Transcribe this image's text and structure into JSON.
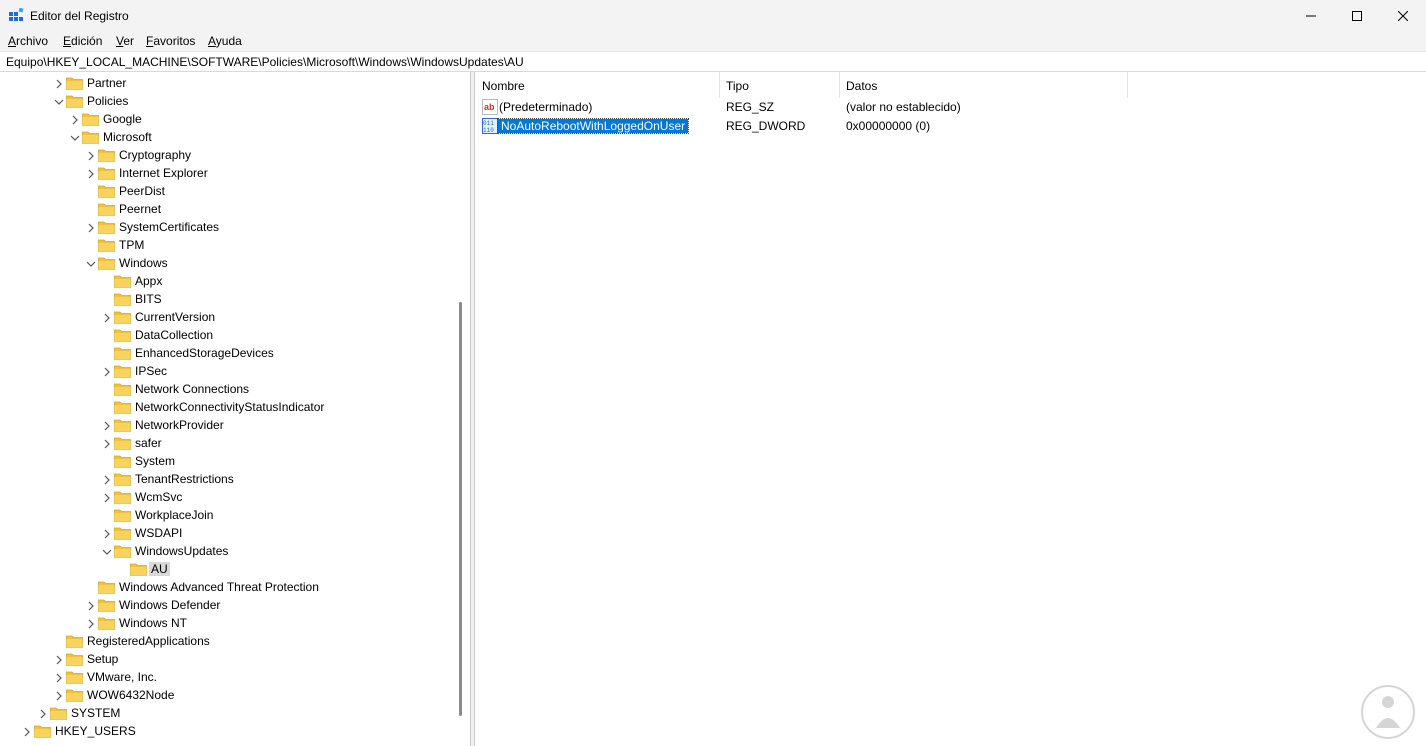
{
  "window": {
    "title": "Editor del Registro",
    "accent": "#0078d7",
    "folder_color": "#f2c23a"
  },
  "menu": [
    {
      "label": "Archivo",
      "u": "A",
      "rest": "rchivo"
    },
    {
      "label": "Edición",
      "u": "E",
      "rest": "dición"
    },
    {
      "label": "Ver",
      "u": "V",
      "rest": "er"
    },
    {
      "label": "Favoritos",
      "u": "F",
      "rest": "avoritos"
    },
    {
      "label": "Ayuda",
      "u": "A",
      "rest": "yuda"
    }
  ],
  "address": "Equipo\\HKEY_LOCAL_MACHINE\\SOFTWARE\\Policies\\Microsoft\\Windows\\WindowsUpdates\\AU",
  "tree": [
    {
      "label": "Partner",
      "depth": 2,
      "chevron": "right"
    },
    {
      "label": "Policies",
      "depth": 2,
      "chevron": "down"
    },
    {
      "label": "Google",
      "depth": 3,
      "chevron": "right"
    },
    {
      "label": "Microsoft",
      "depth": 3,
      "chevron": "down"
    },
    {
      "label": "Cryptography",
      "depth": 4,
      "chevron": "right"
    },
    {
      "label": "Internet Explorer",
      "depth": 4,
      "chevron": "right"
    },
    {
      "label": "PeerDist",
      "depth": 4,
      "chevron": "none"
    },
    {
      "label": "Peernet",
      "depth": 4,
      "chevron": "none"
    },
    {
      "label": "SystemCertificates",
      "depth": 4,
      "chevron": "right"
    },
    {
      "label": "TPM",
      "depth": 4,
      "chevron": "none"
    },
    {
      "label": "Windows",
      "depth": 4,
      "chevron": "down"
    },
    {
      "label": "Appx",
      "depth": 5,
      "chevron": "none"
    },
    {
      "label": "BITS",
      "depth": 5,
      "chevron": "none"
    },
    {
      "label": "CurrentVersion",
      "depth": 5,
      "chevron": "right"
    },
    {
      "label": "DataCollection",
      "depth": 5,
      "chevron": "none"
    },
    {
      "label": "EnhancedStorageDevices",
      "depth": 5,
      "chevron": "none"
    },
    {
      "label": "IPSec",
      "depth": 5,
      "chevron": "right"
    },
    {
      "label": "Network Connections",
      "depth": 5,
      "chevron": "none"
    },
    {
      "label": "NetworkConnectivityStatusIndicator",
      "depth": 5,
      "chevron": "none"
    },
    {
      "label": "NetworkProvider",
      "depth": 5,
      "chevron": "right"
    },
    {
      "label": "safer",
      "depth": 5,
      "chevron": "right"
    },
    {
      "label": "System",
      "depth": 5,
      "chevron": "none"
    },
    {
      "label": "TenantRestrictions",
      "depth": 5,
      "chevron": "right"
    },
    {
      "label": "WcmSvc",
      "depth": 5,
      "chevron": "right"
    },
    {
      "label": "WorkplaceJoin",
      "depth": 5,
      "chevron": "none"
    },
    {
      "label": "WSDAPI",
      "depth": 5,
      "chevron": "right"
    },
    {
      "label": "WindowsUpdates",
      "depth": 5,
      "chevron": "down"
    },
    {
      "label": "AU",
      "depth": 6,
      "chevron": "none",
      "selected": true
    },
    {
      "label": "Windows Advanced Threat Protection",
      "depth": 4,
      "chevron": "none"
    },
    {
      "label": "Windows Defender",
      "depth": 4,
      "chevron": "right"
    },
    {
      "label": "Windows NT",
      "depth": 4,
      "chevron": "right"
    },
    {
      "label": "RegisteredApplications",
      "depth": 2,
      "chevron": "none"
    },
    {
      "label": "Setup",
      "depth": 2,
      "chevron": "right"
    },
    {
      "label": "VMware, Inc.",
      "depth": 2,
      "chevron": "right"
    },
    {
      "label": "WOW6432Node",
      "depth": 2,
      "chevron": "right"
    },
    {
      "label": "SYSTEM",
      "depth": 1,
      "chevron": "right"
    },
    {
      "label": "HKEY_USERS",
      "depth": 0,
      "chevron": "right"
    }
  ],
  "columns": {
    "name": "Nombre",
    "type": "Tipo",
    "data": "Datos"
  },
  "values": [
    {
      "name": "(Predeterminado)",
      "type": "REG_SZ",
      "data": "(valor no establecido)",
      "icon": "string-value-icon"
    },
    {
      "name": "NoAutoRebootWithLoggedOnUser",
      "type": "REG_DWORD",
      "data": "0x00000000 (0)",
      "icon": "binary-value-icon",
      "selected": true
    }
  ]
}
